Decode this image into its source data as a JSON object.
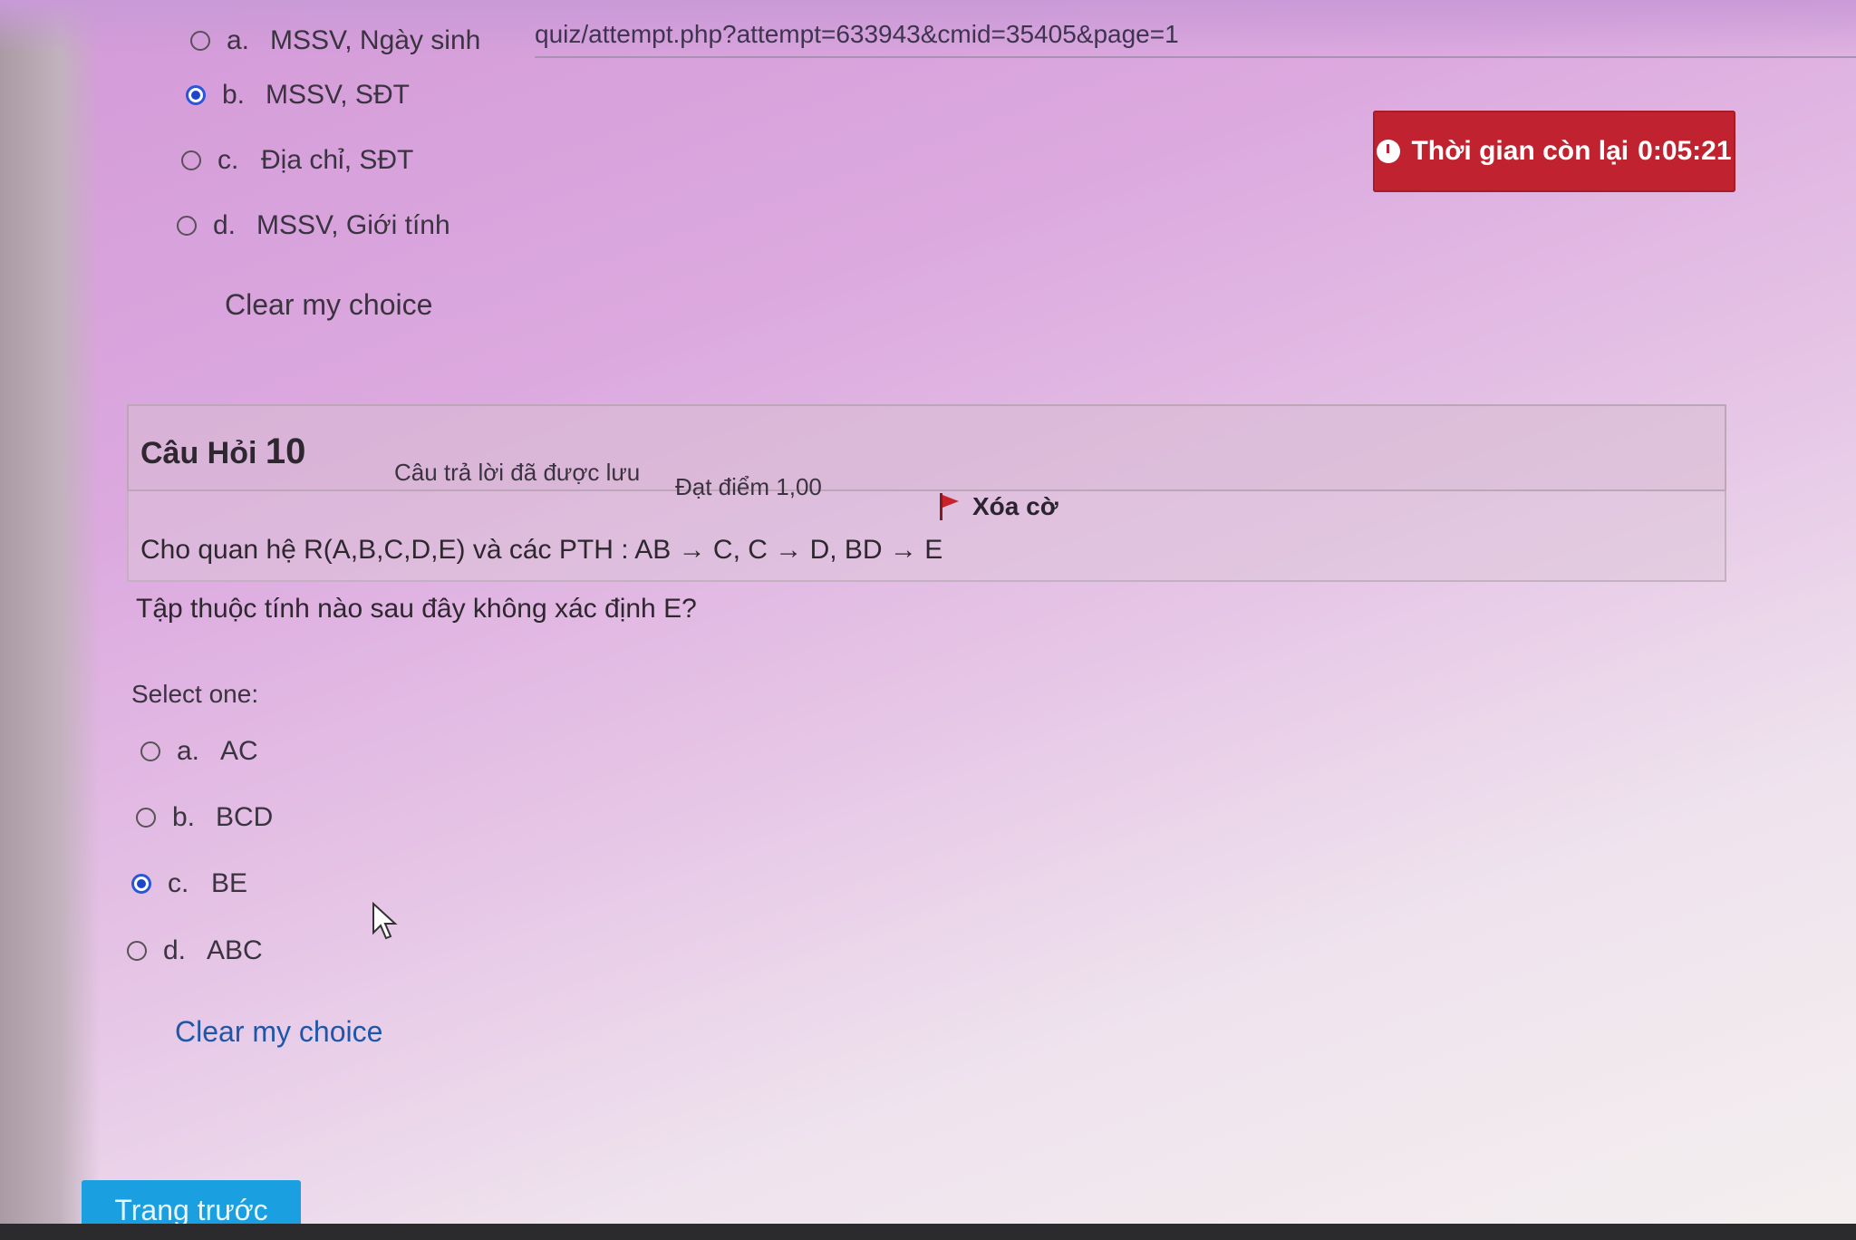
{
  "url": "quiz/attempt.php?attempt=633943&cmid=35405&page=1",
  "timer": {
    "label": "Thời gian còn lại",
    "value": "0:05:21"
  },
  "question9": {
    "options": [
      {
        "letter": "a.",
        "text": "MSSV, Ngày sinh",
        "selected": false
      },
      {
        "letter": "b.",
        "text": "MSSV, SĐT",
        "selected": true
      },
      {
        "letter": "c.",
        "text": "Địa chỉ, SĐT",
        "selected": false
      },
      {
        "letter": "d.",
        "text": "MSSV, Giới tính",
        "selected": false
      }
    ],
    "clear_label": "Clear my choice"
  },
  "question10": {
    "title": "Câu Hỏi",
    "number": "10",
    "state": "Câu trả lời đã được lưu",
    "grade": "Đạt điểm 1,00",
    "flag_label": "Xóa cờ",
    "text_line1": "Cho quan hệ R(A,B,C,D,E) và các PTH : AB → C, C → D, BD → E",
    "text_line2": "Tập thuộc tính nào sau đây không xác định E?",
    "select_one": "Select one:",
    "options": [
      {
        "letter": "a.",
        "text": "AC",
        "selected": false
      },
      {
        "letter": "b.",
        "text": "BCD",
        "selected": false
      },
      {
        "letter": "c.",
        "text": "BE",
        "selected": true
      },
      {
        "letter": "d.",
        "text": "ABC",
        "selected": false
      }
    ],
    "clear_label": "Clear my choice"
  },
  "nav": {
    "prev_label": "Trang trước"
  },
  "colors": {
    "timer_bg": "#c0232f",
    "button_bg": "#1a9fe0",
    "radio_selected": "#1d46cc"
  }
}
